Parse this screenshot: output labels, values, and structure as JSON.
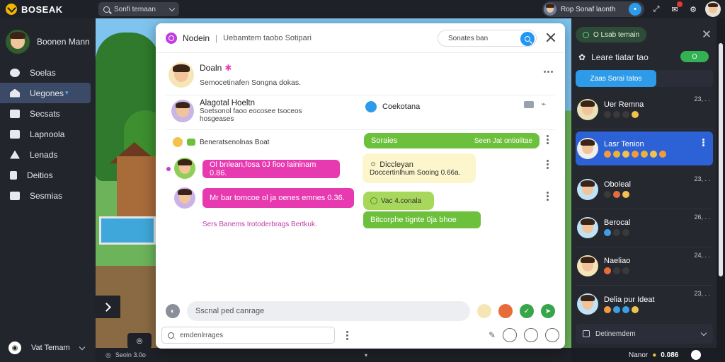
{
  "app": {
    "title": "BOSEAK"
  },
  "topbar": {
    "search_label": "Sonfi temaan",
    "user_pill": "Rop Sonaf laonth"
  },
  "sidebar": {
    "profile_name": "Boonen Mann",
    "items": [
      {
        "label": "Soelas",
        "icon": "globe-icon"
      },
      {
        "label": "Uegones",
        "icon": "home-icon",
        "active": true
      },
      {
        "label": "Secsats",
        "icon": "feed-icon"
      },
      {
        "label": "Lapnoola",
        "icon": "folder-icon"
      },
      {
        "label": "Lenads",
        "icon": "lock-icon"
      },
      {
        "label": "Deitios",
        "icon": "book-icon"
      },
      {
        "label": "Sesmias",
        "icon": "settings-icon"
      }
    ],
    "footer_label": "Vat Temam"
  },
  "gamebar": {
    "left": "Seoln 3.0o",
    "right_label": "Nanor",
    "right_value": "0.086"
  },
  "chat": {
    "title": "Nodein",
    "subtitle": "Uebamtem taobo Sotipari",
    "search_label": "Sonates ban",
    "header_contact": {
      "name": "Doaln",
      "status": "Semocetinafen Songna dokas."
    },
    "group": {
      "name": "Alagotal Hoeltn",
      "desc1": "Soetsonol faoo eocosee tsoceos",
      "desc2": "hosgeases",
      "tag": "Coekotana"
    },
    "messages": [
      {
        "side": "left",
        "label": "Beneratsenolnas Boat"
      },
      {
        "side": "left",
        "text": "Ol bnlean,fosa 0J fioo laininam 0.86."
      },
      {
        "side": "left",
        "text": "Mr bar tomcoe ol ja oenes emnes 0.36."
      },
      {
        "side": "left",
        "text": "Sers Banems Irotoderbrags Bertkuk."
      },
      {
        "side": "right",
        "label": "Soraies",
        "meta": "Seen Jat ontiolitae"
      },
      {
        "side": "right",
        "title": "Diccleyan",
        "text": "Doccertinlhum Sooing 0.66a."
      },
      {
        "side": "right",
        "text": "Vac 4.conala"
      },
      {
        "side": "right",
        "text": "Bitcorphe tignte 0ja bhoe"
      }
    ],
    "composer_placeholder": "Sscnal ped canrage",
    "mini_search": "emdenlrrages"
  },
  "right_panel": {
    "top_button": "O Lsab temain",
    "header": "Leare tiatar tao",
    "toggle": "O",
    "tab_active": "Zaas Sorai tatos",
    "friends": [
      {
        "name": "Uer Remna",
        "time": "23, . .",
        "emoji": [
          "#f2c14e"
        ]
      },
      {
        "name": "Lasr Tenion",
        "time": "",
        "emoji": [
          "#f29b3c",
          "#e9b23a",
          "#f2c14e",
          "#f29b3c",
          "#e9b23a",
          "#f2c14e",
          "#f29b3c"
        ],
        "highlight": true
      },
      {
        "name": "Oboleal",
        "time": "23, . .",
        "emoji": [
          "#e86b3a",
          "#f2c14e"
        ]
      },
      {
        "name": "Berocal",
        "time": "26, . .",
        "emoji": [
          "#3ba0e8",
          "#3ba0e8"
        ]
      },
      {
        "name": "Naeliao",
        "time": "24, . .",
        "emoji": [
          "#e86b3a",
          "#e86b3a",
          "#e86b3a"
        ]
      },
      {
        "name": "Delia pur Ideat",
        "time": "23, . .",
        "emoji": [
          "#f29b3c",
          "#3ba0e8",
          "#3ba0e8",
          "#f2c14e"
        ]
      }
    ],
    "footer": "Detinemdem"
  },
  "colors": {
    "accent": "#2e9be8",
    "pink": "#e83ab0",
    "green": "#6dc03b",
    "active_nav": "#3b4a66"
  }
}
